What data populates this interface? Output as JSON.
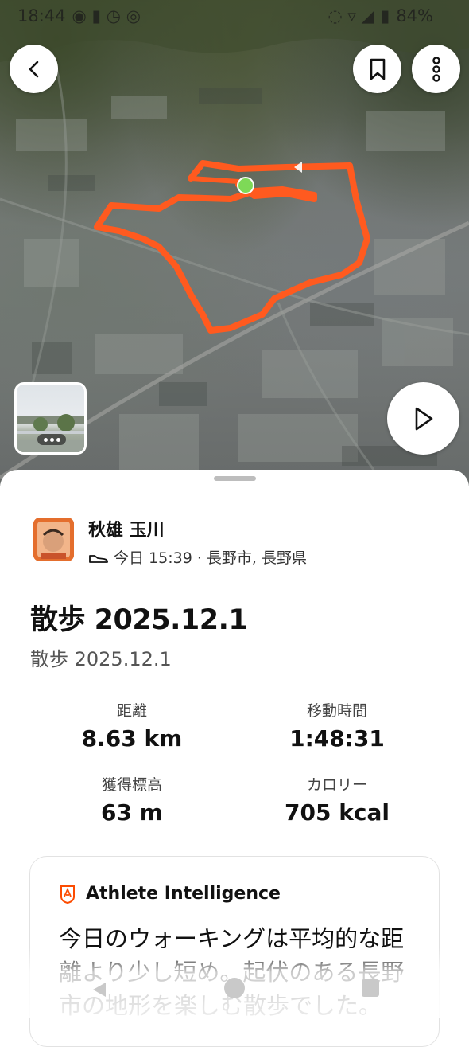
{
  "status_bar": {
    "time": "18:44",
    "battery": "84%"
  },
  "map": {
    "route_color": "#ff5a1f",
    "start_marker_color": "#7ed957"
  },
  "activity": {
    "athlete_name": "秋雄 玉川",
    "meta": "今日 15:39 · 長野市, 長野県",
    "title": "散歩 2025.12.1",
    "subtitle": "散歩 2025.12.1"
  },
  "stats": {
    "distance_label": "距離",
    "distance_value": "8.63 km",
    "moving_time_label": "移動時間",
    "moving_time_value": "1:48:31",
    "elevation_label": "獲得標高",
    "elevation_value": "63 m",
    "calories_label": "カロリー",
    "calories_value": "705 kcal"
  },
  "athlete_intelligence": {
    "title": "Athlete Intelligence",
    "body": "今日のウォーキングは平均的な距離より少し短め。起伏のある長野市の地形を楽しむ散歩でした。"
  },
  "icons": {
    "back": "chevron-left-icon",
    "bookmark": "bookmark-icon",
    "more": "more-vertical-icon",
    "play": "play-icon",
    "shoe": "shoe-icon",
    "ai": "athlete-intelligence-icon"
  },
  "colors": {
    "accent": "#fc4c02",
    "text": "#111111"
  }
}
